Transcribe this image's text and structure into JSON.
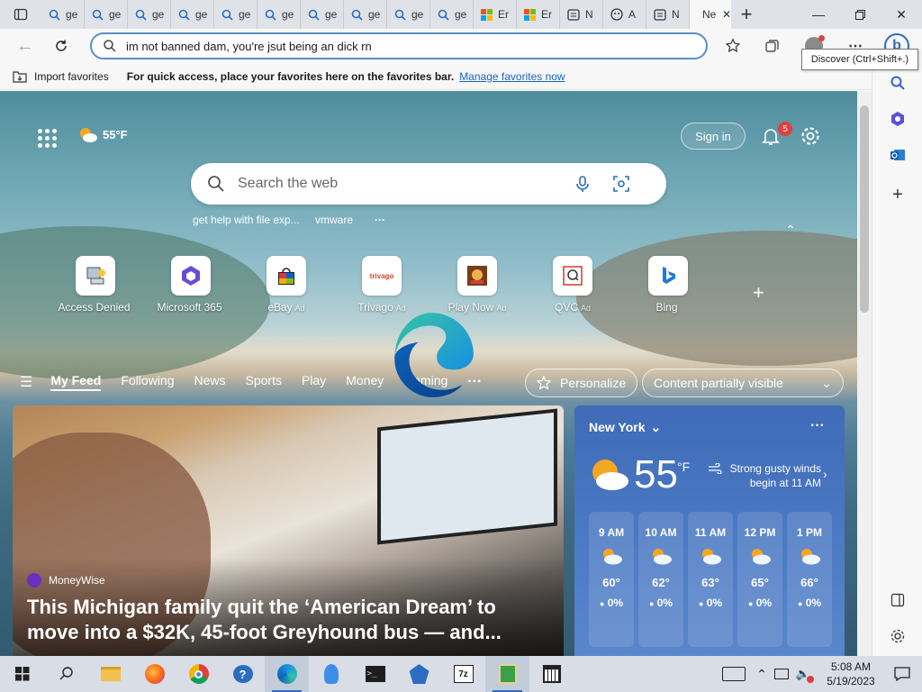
{
  "tabs": [
    {
      "label": "ge",
      "icon": "search-icon"
    },
    {
      "label": "ge",
      "icon": "search-icon"
    },
    {
      "label": "ge",
      "icon": "search-icon"
    },
    {
      "label": "ge",
      "icon": "search-icon"
    },
    {
      "label": "ge",
      "icon": "search-icon"
    },
    {
      "label": "ge",
      "icon": "search-icon"
    },
    {
      "label": "ge",
      "icon": "search-icon"
    },
    {
      "label": "ge",
      "icon": "search-icon"
    },
    {
      "label": "ge",
      "icon": "search-icon"
    },
    {
      "label": "ge",
      "icon": "search-icon"
    },
    {
      "label": "Er",
      "icon": "microsoft-logo-icon"
    },
    {
      "label": "Er",
      "icon": "microsoft-logo-icon"
    },
    {
      "label": "N",
      "icon": "news-icon"
    },
    {
      "label": "A",
      "icon": "copilot-icon"
    },
    {
      "label": "N",
      "icon": "news-icon"
    },
    {
      "label": "Ne",
      "icon": "page-icon",
      "active": true
    }
  ],
  "address": {
    "value": "im not banned dam, you're jsut being an dick rn"
  },
  "tooltip": "Discover (Ctrl+Shift+.)",
  "favbar": {
    "import": "Import favorites",
    "message": "For quick access, place your favorites here on the favorites bar.",
    "link": "Manage favorites now"
  },
  "ntp": {
    "temp": "55°F",
    "sign_in": "Sign in",
    "notif_count": "5",
    "search_placeholder": "Search the web",
    "suggestions": [
      "get help with file exp...",
      "vmware"
    ],
    "tiles": [
      {
        "label": "Access Denied",
        "ad": ""
      },
      {
        "label": "Microsoft 365",
        "ad": ""
      },
      {
        "label": "eBay",
        "ad": "Ad"
      },
      {
        "label": "Trivago",
        "ad": "Ad"
      },
      {
        "label": "Play Now",
        "ad": "Ad"
      },
      {
        "label": "QVC",
        "ad": "Ad"
      },
      {
        "label": "Bing",
        "ad": ""
      }
    ],
    "feed_nav": [
      "My Feed",
      "Following",
      "News",
      "Sports",
      "Play",
      "Money",
      "Gaming"
    ],
    "personalize": "Personalize",
    "content_visibility": "Content partially visible"
  },
  "news_card": {
    "source": "MoneyWise",
    "headline": "This Michigan family quit the ‘American Dream’ to move into a $32K, 45-foot Greyhound bus — and..."
  },
  "weather": {
    "location": "New York",
    "temp": "55",
    "unit": "°F",
    "alert": "Strong gusty winds begin at 11 AM",
    "hourly": [
      {
        "time": "9 AM",
        "temp": "60°",
        "precip": "0%"
      },
      {
        "time": "10 AM",
        "temp": "62°",
        "precip": "0%"
      },
      {
        "time": "11 AM",
        "temp": "63°",
        "precip": "0%"
      },
      {
        "time": "12 PM",
        "temp": "65°",
        "precip": "0%"
      },
      {
        "time": "1 PM",
        "temp": "66°",
        "precip": "0%"
      }
    ]
  },
  "clock": {
    "time": "5:08 AM",
    "date": "5/19/2023"
  },
  "colors": {
    "accent": "#2d6cc0",
    "weather_bg": "#4a78c2",
    "badge": "#e0403c"
  }
}
